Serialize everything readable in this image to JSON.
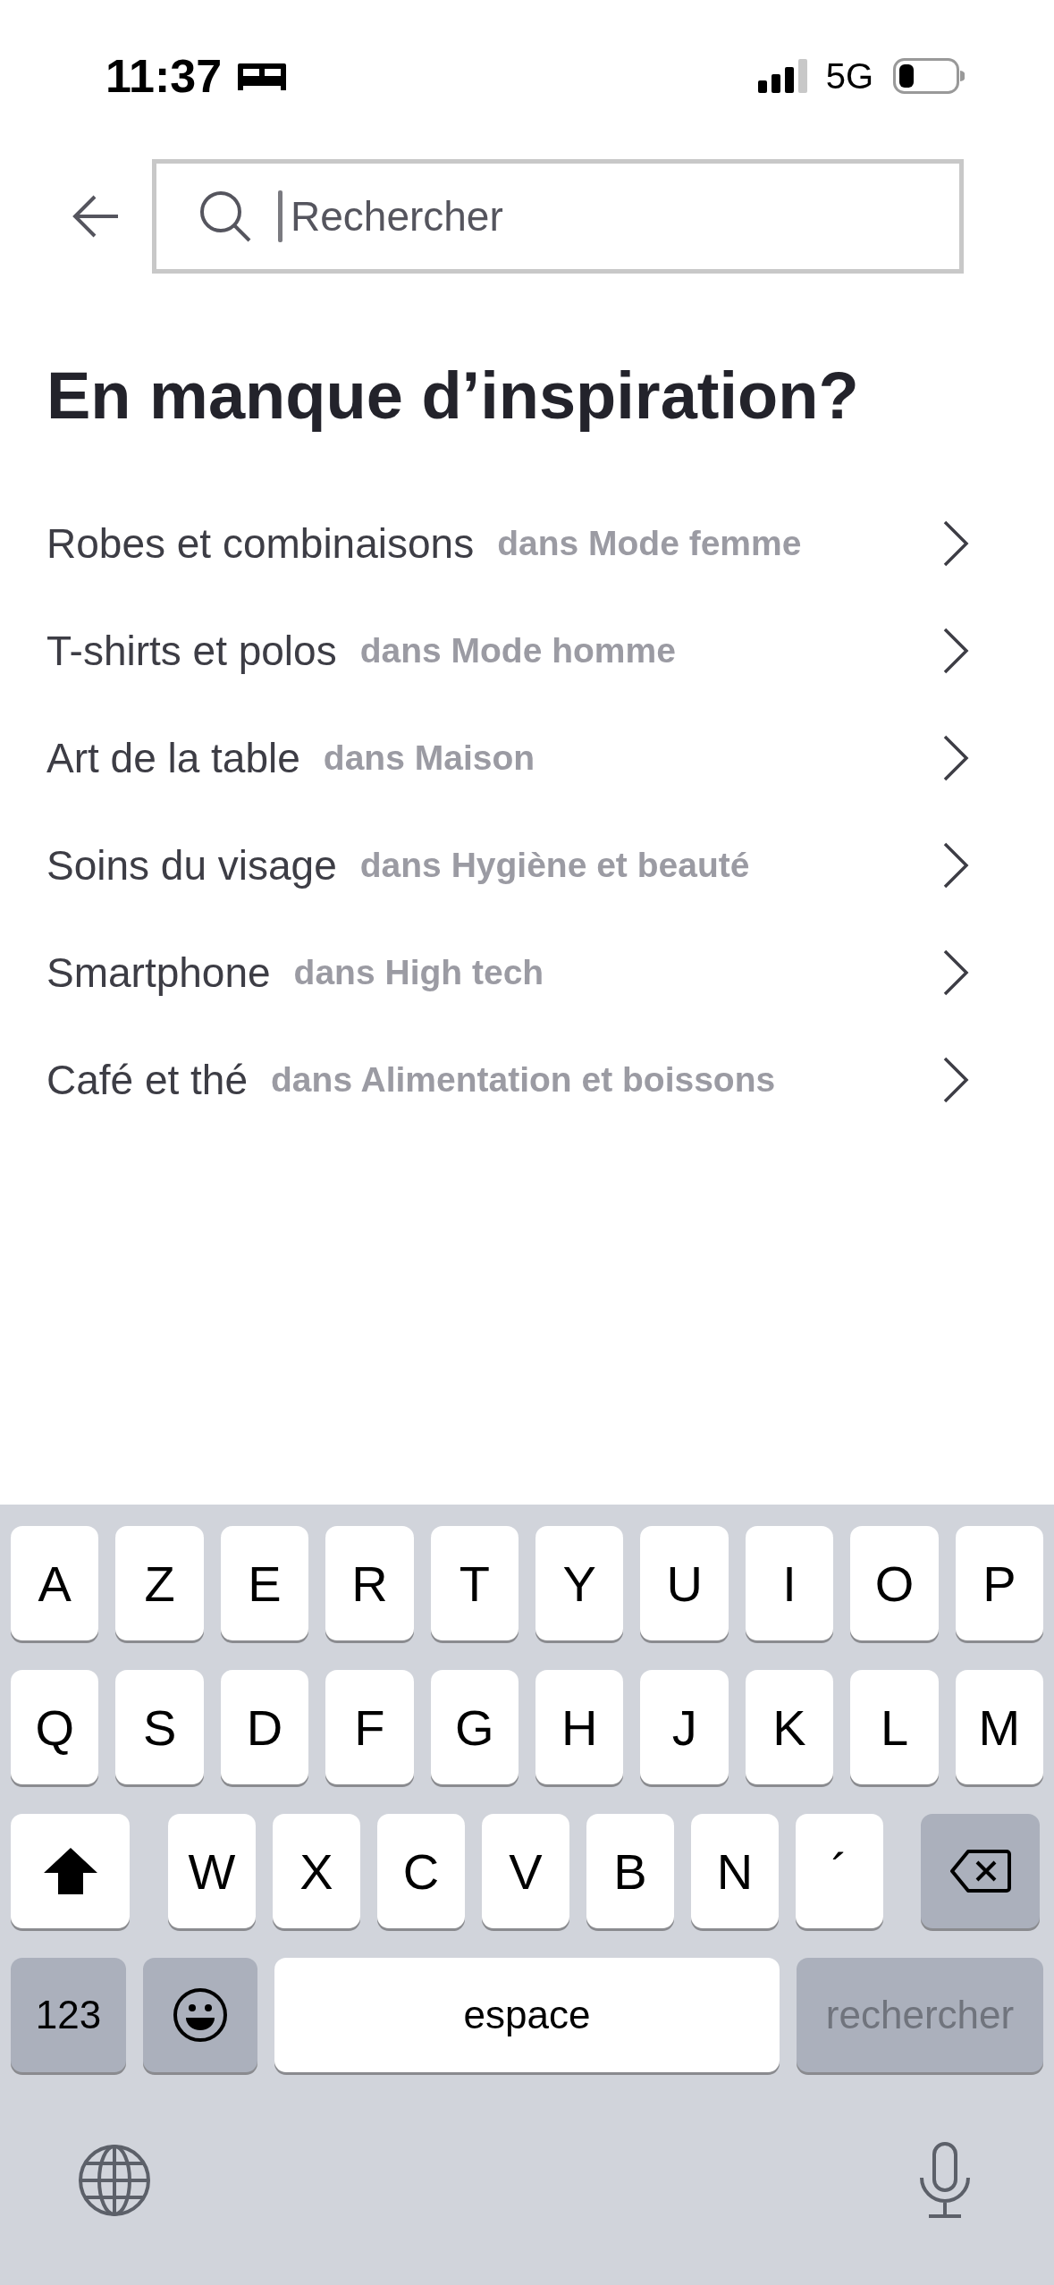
{
  "status_bar": {
    "time": "11:37",
    "network": "5G"
  },
  "search": {
    "placeholder": "Rechercher"
  },
  "heading": "En manque d’inspiration?",
  "suggestions": [
    {
      "label": "Robes et combinaisons",
      "category": "dans Mode femme"
    },
    {
      "label": "T-shirts et polos",
      "category": "dans Mode homme"
    },
    {
      "label": "Art de la table",
      "category": "dans Maison"
    },
    {
      "label": "Soins du visage",
      "category": "dans Hygiène et beauté"
    },
    {
      "label": "Smartphone",
      "category": "dans High tech"
    },
    {
      "label": "Café et thé",
      "category": "dans Alimentation et boissons"
    }
  ],
  "keyboard": {
    "rows": [
      {
        "keys": [
          {
            "kind": "letter",
            "label": "A"
          },
          {
            "kind": "letter",
            "label": "Z"
          },
          {
            "kind": "letter",
            "label": "E"
          },
          {
            "kind": "letter",
            "label": "R"
          },
          {
            "kind": "letter",
            "label": "T"
          },
          {
            "kind": "letter",
            "label": "Y"
          },
          {
            "kind": "letter",
            "label": "U"
          },
          {
            "kind": "letter",
            "label": "I"
          },
          {
            "kind": "letter",
            "label": "O"
          },
          {
            "kind": "letter",
            "label": "P"
          }
        ]
      },
      {
        "keys": [
          {
            "kind": "letter",
            "label": "Q"
          },
          {
            "kind": "letter",
            "label": "S"
          },
          {
            "kind": "letter",
            "label": "D"
          },
          {
            "kind": "letter",
            "label": "F"
          },
          {
            "kind": "letter",
            "label": "G"
          },
          {
            "kind": "letter",
            "label": "H"
          },
          {
            "kind": "letter",
            "label": "J"
          },
          {
            "kind": "letter",
            "label": "K"
          },
          {
            "kind": "letter",
            "label": "L"
          },
          {
            "kind": "letter",
            "label": "M"
          }
        ]
      },
      {
        "keys": [
          {
            "kind": "shift",
            "on": true
          },
          {
            "kind": "letter",
            "label": "W"
          },
          {
            "kind": "letter",
            "label": "X"
          },
          {
            "kind": "letter",
            "label": "C"
          },
          {
            "kind": "letter",
            "label": "V"
          },
          {
            "kind": "letter",
            "label": "B"
          },
          {
            "kind": "letter",
            "label": "N"
          },
          {
            "kind": "letter",
            "label": "´"
          },
          {
            "kind": "delete"
          }
        ]
      },
      {
        "keys": [
          {
            "kind": "numbers",
            "label": "123"
          },
          {
            "kind": "emoji"
          },
          {
            "kind": "space",
            "label": "espace"
          },
          {
            "kind": "action",
            "label": "rechercher",
            "disabled": true
          }
        ]
      }
    ]
  }
}
